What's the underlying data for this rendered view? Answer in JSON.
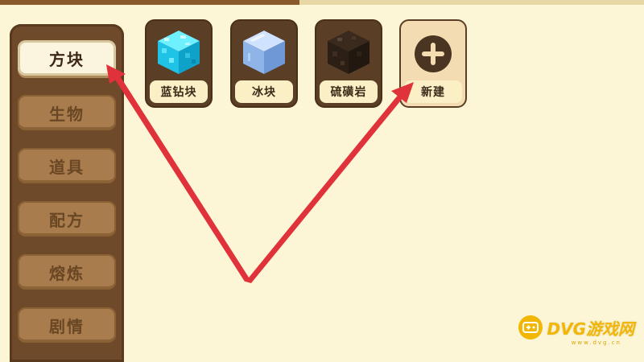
{
  "sidebar": {
    "tabs": [
      {
        "label": "方块",
        "active": true
      },
      {
        "label": "生物",
        "active": false
      },
      {
        "label": "道具",
        "active": false
      },
      {
        "label": "配方",
        "active": false
      },
      {
        "label": "熔炼",
        "active": false
      },
      {
        "label": "剧情",
        "active": false
      }
    ]
  },
  "items": [
    {
      "label": "蓝钻块",
      "icon": "diamond-block-icon"
    },
    {
      "label": "冰块",
      "icon": "ice-block-icon"
    },
    {
      "label": "硫磺岩",
      "icon": "sulfur-rock-icon"
    }
  ],
  "new_item": {
    "label": "新建",
    "icon": "plus-icon"
  },
  "colors": {
    "background": "#fdf6d6",
    "sidebar": "#6e4a2a",
    "arrow": "#e0323a",
    "watermark": "#f2b705"
  },
  "watermark": {
    "text": "DVG游戏网",
    "sub": "www.dvg.cn"
  }
}
